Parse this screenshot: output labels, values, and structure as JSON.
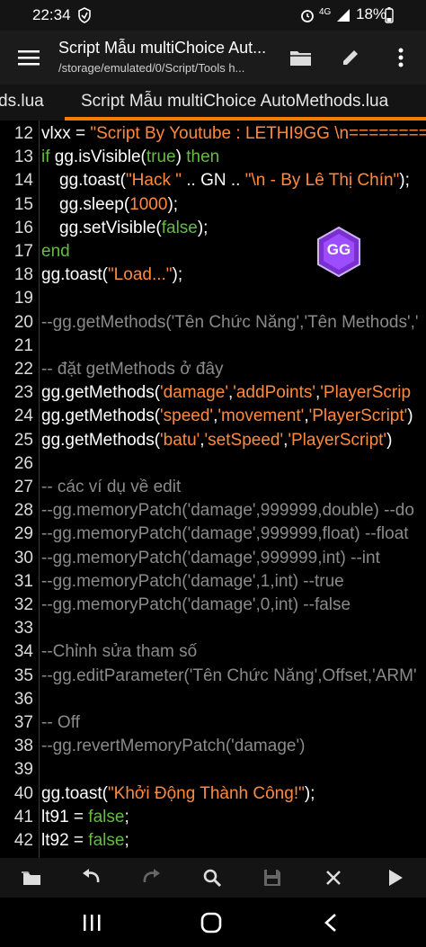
{
  "status_bar": {
    "time": "22:34",
    "signal_text": "4G",
    "battery": "18%"
  },
  "app_bar": {
    "title": "Script Mẫu multiChoice Aut...",
    "subtitle": "/storage/emulated/0/Script/Tools h..."
  },
  "tabs": [
    {
      "label": "ds.lua",
      "active": false
    },
    {
      "label": "Script Mẫu multiChoice AutoMethods.lua",
      "active": true
    }
  ],
  "colors": {
    "accent": "#f57c00",
    "keyword": "#66bb44",
    "string": "#ff8a3d",
    "comment": "#8a8a8a"
  },
  "code_lines": [
    {
      "n": "12",
      "segs": [
        [
          "t",
          "vlxx = "
        ],
        [
          "s",
          "\"Script By Youtube : LETHI9GG \\n========"
        ]
      ]
    },
    {
      "n": "13",
      "segs": [
        [
          "k",
          "if "
        ],
        [
          "t",
          "gg.isVisible("
        ],
        [
          "k",
          "true"
        ],
        [
          "t",
          ") "
        ],
        [
          "k",
          "then"
        ]
      ]
    },
    {
      "n": "14",
      "indent": true,
      "segs": [
        [
          "t",
          "gg.toast("
        ],
        [
          "s",
          "\"Hack \""
        ],
        [
          "t",
          " .. GN .. "
        ],
        [
          "s",
          "\"\\n - By Lê Thị Chín\""
        ],
        [
          "t",
          ");"
        ]
      ]
    },
    {
      "n": "15",
      "indent": true,
      "segs": [
        [
          "t",
          "gg.sleep("
        ],
        [
          "s",
          "1000"
        ],
        [
          "t",
          ");"
        ]
      ]
    },
    {
      "n": "16",
      "indent": true,
      "segs": [
        [
          "t",
          "gg.setVisible("
        ],
        [
          "k",
          "false"
        ],
        [
          "t",
          ");"
        ]
      ]
    },
    {
      "n": "17",
      "segs": [
        [
          "k",
          "end"
        ]
      ]
    },
    {
      "n": "18",
      "segs": [
        [
          "t",
          "gg.toast("
        ],
        [
          "s",
          "\"Load...\""
        ],
        [
          "t",
          ");"
        ]
      ]
    },
    {
      "n": "19",
      "segs": []
    },
    {
      "n": "20",
      "segs": [
        [
          "c",
          "--gg.getMethods('Tên Chức Năng','Tên Methods','"
        ]
      ]
    },
    {
      "n": "21",
      "segs": []
    },
    {
      "n": "22",
      "segs": [
        [
          "c",
          "-- đặt getMethods ở đây"
        ]
      ]
    },
    {
      "n": "23",
      "segs": [
        [
          "t",
          "gg.getMethods("
        ],
        [
          "s",
          "'damage'"
        ],
        [
          "t",
          ","
        ],
        [
          "s",
          "'addPoints'"
        ],
        [
          "t",
          ","
        ],
        [
          "s",
          "'PlayerScrip"
        ]
      ]
    },
    {
      "n": "24",
      "segs": [
        [
          "t",
          "gg.getMethods("
        ],
        [
          "s",
          "'speed'"
        ],
        [
          "t",
          ","
        ],
        [
          "s",
          "'movement'"
        ],
        [
          "t",
          ","
        ],
        [
          "s",
          "'PlayerScript'"
        ],
        [
          "t",
          ")"
        ]
      ]
    },
    {
      "n": "25",
      "segs": [
        [
          "t",
          "gg.getMethods("
        ],
        [
          "s",
          "'batu'"
        ],
        [
          "t",
          ","
        ],
        [
          "s",
          "'setSpeed'"
        ],
        [
          "t",
          ","
        ],
        [
          "s",
          "'PlayerScript'"
        ],
        [
          "t",
          ")"
        ]
      ]
    },
    {
      "n": "26",
      "segs": []
    },
    {
      "n": "27",
      "segs": [
        [
          "c",
          "-- các ví dụ về edit"
        ]
      ]
    },
    {
      "n": "28",
      "segs": [
        [
          "c",
          "--gg.memoryPatch('damage',999999,double) --do"
        ]
      ]
    },
    {
      "n": "29",
      "segs": [
        [
          "c",
          "--gg.memoryPatch('damage',999999,float) --float"
        ]
      ]
    },
    {
      "n": "30",
      "segs": [
        [
          "c",
          "--gg.memoryPatch('damage',999999,int) --int"
        ]
      ]
    },
    {
      "n": "31",
      "segs": [
        [
          "c",
          "--gg.memoryPatch('damage',1,int) --true"
        ]
      ]
    },
    {
      "n": "32",
      "segs": [
        [
          "c",
          "--gg.memoryPatch('damage',0,int) --false"
        ]
      ]
    },
    {
      "n": "33",
      "segs": []
    },
    {
      "n": "34",
      "segs": [
        [
          "c",
          "--Chỉnh sửa tham số"
        ]
      ]
    },
    {
      "n": "35",
      "segs": [
        [
          "c",
          "--gg.editParameter('Tên Chức Năng',Offset,'ARM'"
        ]
      ]
    },
    {
      "n": "36",
      "segs": []
    },
    {
      "n": "37",
      "segs": [
        [
          "c",
          "-- Off"
        ]
      ]
    },
    {
      "n": "38",
      "segs": [
        [
          "c",
          "--gg.revertMemoryPatch('damage')"
        ]
      ]
    },
    {
      "n": "39",
      "segs": []
    },
    {
      "n": "40",
      "segs": [
        [
          "t",
          "gg.toast("
        ],
        [
          "s",
          "\"Khởi Động Thành Công!\""
        ],
        [
          "t",
          ");"
        ]
      ]
    },
    {
      "n": "41",
      "segs": [
        [
          "t",
          "lt91 = "
        ],
        [
          "k",
          "false"
        ],
        [
          "t",
          ";"
        ]
      ]
    },
    {
      "n": "42",
      "segs": [
        [
          "t",
          "lt92 = "
        ],
        [
          "k",
          "false"
        ],
        [
          "t",
          ";"
        ]
      ]
    }
  ],
  "floating_logo": {
    "text": "GG"
  },
  "toolbar_icons": [
    "folder-icon",
    "undo-icon",
    "redo-icon",
    "search-icon",
    "save-icon",
    "close-icon",
    "run-icon"
  ],
  "nav_icons": [
    "recent-apps-icon",
    "home-icon",
    "back-icon"
  ]
}
